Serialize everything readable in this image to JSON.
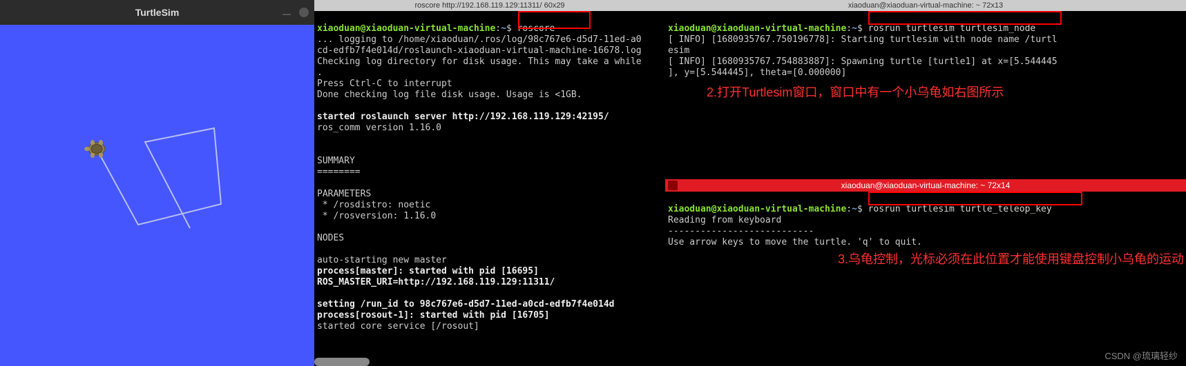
{
  "turtlesim": {
    "title": "TurtleSim"
  },
  "term1": {
    "header": "roscore http://192.168.119.129:11311/ 60x29",
    "prompt_user": "xiaoduan@xiaoduan-virtual-machine",
    "prompt_path": "~",
    "prompt_dollar": "$",
    "cmd": "roscore",
    "line1": "... logging to /home/xiaoduan/.ros/log/98c767e6-d5d7-11ed-a0",
    "line2": "cd-edfb7f4e014d/roslaunch-xiaoduan-virtual-machine-16678.log",
    "line3": "Checking log directory for disk usage. This may take a while",
    "line4": ".",
    "line5": "Press Ctrl-C to interrupt",
    "line6": "Done checking log file disk usage. Usage is <1GB.",
    "line7": "started roslaunch server http://192.168.119.129:42195/",
    "line8": "ros_comm version 1.16.0",
    "summary": "SUMMARY",
    "sep": "========",
    "params": "PARAMETERS",
    "param1": " * /rosdistro: noetic",
    "param2": " * /rosversion: 1.16.0",
    "nodes": "NODES",
    "line9": "auto-starting new master",
    "line10": "process[master]: started with pid [16695]",
    "line11": "ROS_MASTER_URI=http://192.168.119.129:11311/",
    "line12": "setting /run_id to 98c767e6-d5d7-11ed-a0cd-edfb7f4e014d",
    "line13": "process[rosout-1]: started with pid [16705]",
    "line14": "started core service [/rosout]"
  },
  "term2": {
    "header": "xiaoduan@xiaoduan-virtual-machine: ~ 72x13",
    "prompt_user": "xiaoduan@xiaoduan-virtual-machine",
    "prompt_path": "~",
    "prompt_dollar": "$",
    "cmd": "rosrun turtlesim turtlesim_node",
    "line1": "[ INFO] [1680935767.750196778]: Starting turtlesim with node name /turtl",
    "line2": "esim",
    "line3": "[ INFO] [1680935767.754883887]: Spawning turtle [turtle1] at x=[5.544445",
    "line4": "], y=[5.544445], theta=[0.000000]",
    "annotation": "2.打开Turtlesim窗口，窗口中有一个小乌龟如右图所示"
  },
  "term3": {
    "header": "xiaoduan@xiaoduan-virtual-machine: ~ 72x14",
    "prompt_user": "xiaoduan@xiaoduan-virtual-machine",
    "prompt_path": "~",
    "prompt_dollar": "$",
    "cmd": "rosrun turtlesim turtle_teleop_key",
    "line1": "Reading from keyboard",
    "line2": "---------------------------",
    "line3": "Use arrow keys to move the turtle. 'q' to quit.",
    "annotation": "3.乌龟控制，光标必须在此位置才能使用键盘控制小乌龟的运动"
  },
  "watermark": "CSDN @琉璃轻纱"
}
